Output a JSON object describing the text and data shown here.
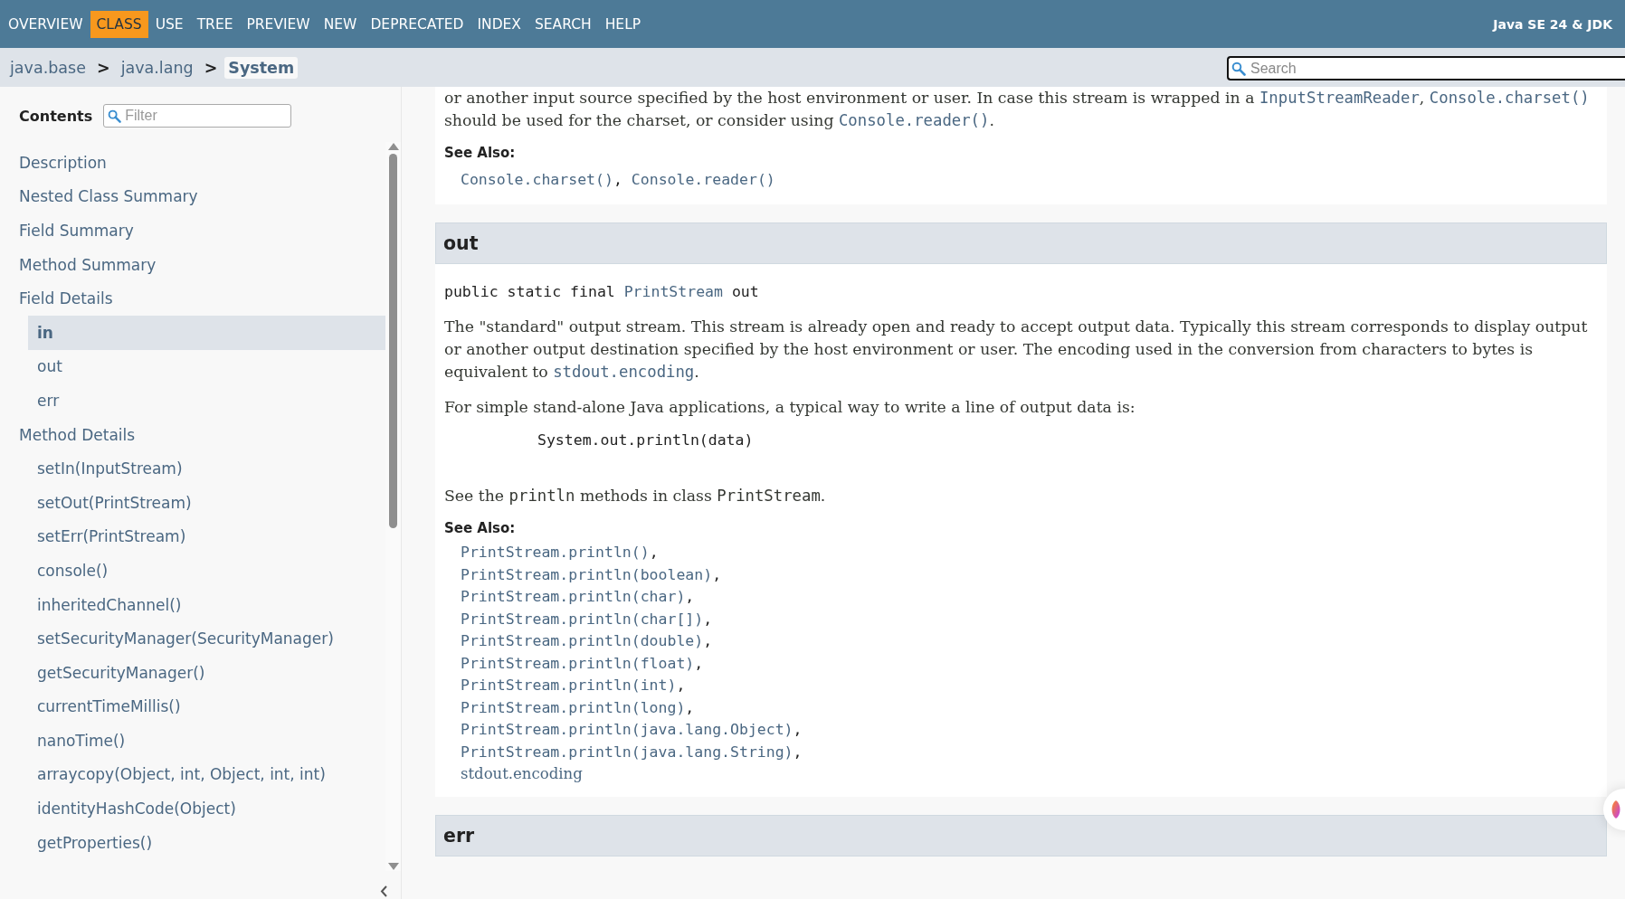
{
  "nav": {
    "items": [
      {
        "label": "OVERVIEW",
        "selected": false
      },
      {
        "label": "CLASS",
        "selected": true
      },
      {
        "label": "USE",
        "selected": false
      },
      {
        "label": "TREE",
        "selected": false
      },
      {
        "label": "PREVIEW",
        "selected": false
      },
      {
        "label": "NEW",
        "selected": false
      },
      {
        "label": "DEPRECATED",
        "selected": false
      },
      {
        "label": "INDEX",
        "selected": false
      },
      {
        "label": "SEARCH",
        "selected": false
      },
      {
        "label": "HELP",
        "selected": false
      }
    ],
    "title": "Java SE 24 & JDK"
  },
  "breadcrumb": [
    {
      "label": "java.base",
      "selected": false
    },
    {
      "label": "java.lang",
      "selected": false
    },
    {
      "label": "System",
      "selected": true
    }
  ],
  "breadcrumb_separator": ">",
  "search": {
    "placeholder": "Search"
  },
  "sidebar": {
    "title": "Contents",
    "filter": {
      "placeholder": "Filter"
    },
    "items": [
      {
        "label": "Description",
        "selected": false
      },
      {
        "label": "Nested Class Summary",
        "selected": false
      },
      {
        "label": "Field Summary",
        "selected": false
      },
      {
        "label": "Method Summary",
        "selected": false
      },
      {
        "label": "Field Details",
        "selected": false,
        "children": [
          {
            "label": "in",
            "selected": true
          },
          {
            "label": "out",
            "selected": false
          },
          {
            "label": "err",
            "selected": false
          }
        ]
      },
      {
        "label": "Method Details",
        "selected": false,
        "children": [
          {
            "label": "setIn(InputStream)",
            "selected": false
          },
          {
            "label": "setOut(PrintStream)",
            "selected": false
          },
          {
            "label": "setErr(PrintStream)",
            "selected": false
          },
          {
            "label": "console()",
            "selected": false
          },
          {
            "label": "inheritedChannel()",
            "selected": false
          },
          {
            "label": "setSecurityManager(SecurityManager)",
            "selected": false
          },
          {
            "label": "getSecurityManager()",
            "selected": false
          },
          {
            "label": "currentTimeMillis()",
            "selected": false
          },
          {
            "label": "nanoTime()",
            "selected": false
          },
          {
            "label": "arraycopy(Object, int, Object, int, int)",
            "selected": false
          },
          {
            "label": "identityHashCode(Object)",
            "selected": false
          },
          {
            "label": "getProperties()",
            "selected": false
          }
        ]
      }
    ]
  },
  "sections": [
    {
      "blocks": [
        {
          "kind": "paragraph",
          "parts": [
            {
              "kind": "text",
              "text": "or another input source specified by the host environment or user. In case this stream is wrapped in a "
            },
            {
              "kind": "link",
              "text": "InputStreamReader"
            },
            {
              "kind": "text",
              "text": ", "
            },
            {
              "kind": "link",
              "text": "Console.charset()"
            },
            {
              "kind": "text",
              "text": " should be used for the charset, or consider using "
            },
            {
              "kind": "link",
              "text": "Console.reader()"
            },
            {
              "kind": "text",
              "text": "."
            }
          ]
        },
        {
          "kind": "see_also_inline",
          "label": "See Also:",
          "links": [
            {
              "kind": "code_link",
              "text": "Console.charset()",
              "suffix": ","
            },
            {
              "kind": "code_link",
              "text": "Console.reader()"
            }
          ]
        }
      ]
    },
    {
      "heading": "out",
      "blocks": [
        {
          "kind": "signature",
          "parts": [
            {
              "kind": "text",
              "text": "public static final "
            },
            {
              "kind": "link",
              "text": "PrintStream"
            },
            {
              "kind": "text",
              "text": " out"
            }
          ]
        },
        {
          "kind": "paragraph",
          "parts": [
            {
              "kind": "text",
              "text": "The \"standard\" output stream. This stream is already open and ready to accept output data. Typically this stream corresponds to display output or another output destination specified by the host environment or user. The encoding used in the conversion from characters to bytes is equivalent to "
            },
            {
              "kind": "link",
              "text": "stdout.encoding"
            },
            {
              "kind": "text",
              "text": "."
            }
          ]
        },
        {
          "kind": "paragraph",
          "parts": [
            {
              "kind": "text",
              "text": "For simple stand-alone Java applications, a typical way to write a line of output data is:"
            }
          ]
        },
        {
          "kind": "code",
          "text": "System.out.println(data)"
        },
        {
          "kind": "paragraph",
          "parts": [
            {
              "kind": "text",
              "text": "See the "
            },
            {
              "kind": "code",
              "text": "println"
            },
            {
              "kind": "text",
              "text": " methods in class "
            },
            {
              "kind": "code",
              "text": "PrintStream"
            },
            {
              "kind": "text",
              "text": "."
            }
          ]
        },
        {
          "kind": "see_also_list",
          "label": "See Also:",
          "links": [
            {
              "kind": "code_link",
              "text": "PrintStream.println()",
              "suffix": ","
            },
            {
              "kind": "code_link",
              "text": "PrintStream.println(boolean)",
              "suffix": ","
            },
            {
              "kind": "code_link",
              "text": "PrintStream.println(char)",
              "suffix": ","
            },
            {
              "kind": "code_link",
              "text": "PrintStream.println(char[])",
              "suffix": ","
            },
            {
              "kind": "code_link",
              "text": "PrintStream.println(double)",
              "suffix": ","
            },
            {
              "kind": "code_link",
              "text": "PrintStream.println(float)",
              "suffix": ","
            },
            {
              "kind": "code_link",
              "text": "PrintStream.println(int)",
              "suffix": ","
            },
            {
              "kind": "code_link",
              "text": "PrintStream.println(long)",
              "suffix": ","
            },
            {
              "kind": "code_link",
              "text": "PrintStream.println(java.lang.Object)",
              "suffix": ","
            },
            {
              "kind": "code_link",
              "text": "PrintStream.println(java.lang.String)",
              "suffix": ","
            },
            {
              "kind": "text_link",
              "text": "stdout.encoding"
            }
          ]
        }
      ]
    },
    {
      "heading": "err"
    }
  ]
}
